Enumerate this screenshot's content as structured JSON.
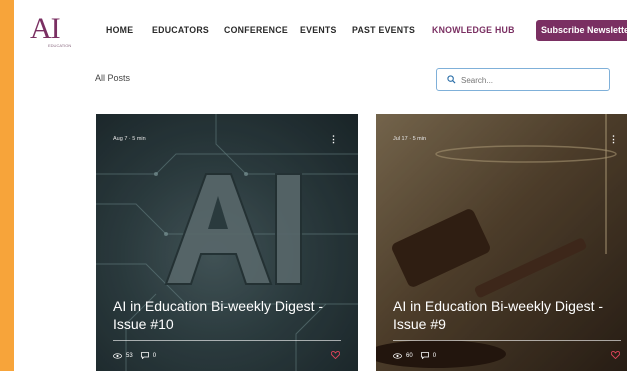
{
  "logo": {
    "letters": "AI",
    "tagline": "EDUCATION"
  },
  "nav": {
    "items": [
      {
        "label": "HOME"
      },
      {
        "label": "EDUCATORS"
      },
      {
        "label": "CONFERENCE"
      },
      {
        "label": "EVENTS"
      },
      {
        "label": "PAST EVENTS"
      },
      {
        "label": "KNOWLEDGE HUB"
      }
    ],
    "subscribe_label": "Subscribe Newsletter"
  },
  "blog": {
    "heading": "All Posts",
    "search_placeholder": "Search..."
  },
  "posts": [
    {
      "date": "Aug 7",
      "read_time": "5 min",
      "title": "AI in Education Bi-weekly Digest - Issue #10",
      "views": "53",
      "comments": "0"
    },
    {
      "date": "Jul 17",
      "read_time": "5 min",
      "title": "AI in Education Bi-weekly Digest - Issue #9",
      "views": "60",
      "comments": "0"
    }
  ],
  "colors": {
    "brand": "#7a2f62",
    "frame": "#f7a43a",
    "heart": "#e0445a"
  }
}
